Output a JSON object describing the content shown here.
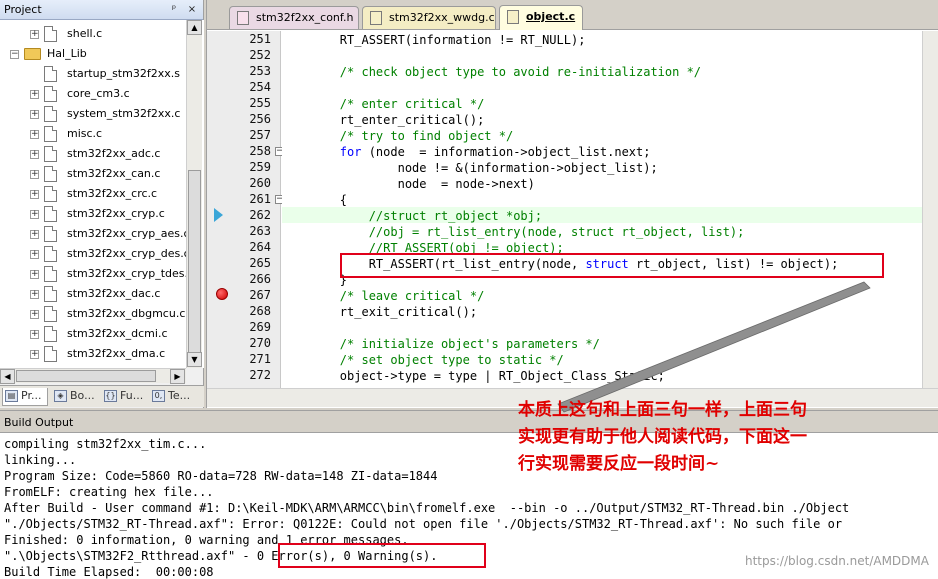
{
  "project": {
    "title": "Project",
    "pin": "ᵖ",
    "close": "×",
    "tree": [
      {
        "label": "shell.c",
        "type": "file",
        "expander": "+",
        "level": 2
      },
      {
        "label": "Hal_Lib",
        "type": "folder",
        "expander": "−",
        "level": 1
      },
      {
        "label": "startup_stm32f2xx.s",
        "type": "file",
        "expander": "",
        "level": 2
      },
      {
        "label": "core_cm3.c",
        "type": "file",
        "expander": "+",
        "level": 2
      },
      {
        "label": "system_stm32f2xx.c",
        "type": "file",
        "expander": "+",
        "level": 2
      },
      {
        "label": "misc.c",
        "type": "file",
        "expander": "+",
        "level": 2
      },
      {
        "label": "stm32f2xx_adc.c",
        "type": "file",
        "expander": "+",
        "level": 2
      },
      {
        "label": "stm32f2xx_can.c",
        "type": "file",
        "expander": "+",
        "level": 2
      },
      {
        "label": "stm32f2xx_crc.c",
        "type": "file",
        "expander": "+",
        "level": 2
      },
      {
        "label": "stm32f2xx_cryp.c",
        "type": "file",
        "expander": "+",
        "level": 2
      },
      {
        "label": "stm32f2xx_cryp_aes.c",
        "type": "file",
        "expander": "+",
        "level": 2
      },
      {
        "label": "stm32f2xx_cryp_des.c",
        "type": "file",
        "expander": "+",
        "level": 2
      },
      {
        "label": "stm32f2xx_cryp_tdes.c",
        "type": "file",
        "expander": "+",
        "level": 2
      },
      {
        "label": "stm32f2xx_dac.c",
        "type": "file",
        "expander": "+",
        "level": 2
      },
      {
        "label": "stm32f2xx_dbgmcu.c",
        "type": "file",
        "expander": "+",
        "level": 2
      },
      {
        "label": "stm32f2xx_dcmi.c",
        "type": "file",
        "expander": "+",
        "level": 2
      },
      {
        "label": "stm32f2xx_dma.c",
        "type": "file",
        "expander": "+",
        "level": 2
      }
    ],
    "tabs": [
      {
        "label": "Pr...",
        "icon": "▤"
      },
      {
        "label": "Bo...",
        "icon": "◈"
      },
      {
        "label": "Fu...",
        "icon": "{}"
      },
      {
        "label": "Te...",
        "icon": "0,"
      }
    ]
  },
  "editor": {
    "tabs": [
      {
        "label": "stm32f2xx_conf.h",
        "kind": "h",
        "active": false
      },
      {
        "label": "stm32f2xx_wwdg.c",
        "kind": "c",
        "active": false
      },
      {
        "label": "object.c",
        "kind": "c",
        "active": true
      }
    ],
    "lines": [
      {
        "no": "251",
        "fold": "",
        "segs": [
          [
            "",
            "        RT_ASSERT(information != RT_NULL);"
          ]
        ]
      },
      {
        "no": "252",
        "fold": "",
        "segs": [
          [
            "",
            ""
          ]
        ]
      },
      {
        "no": "253",
        "fold": "",
        "segs": [
          [
            "cm",
            "        /* check object type to avoid re-initialization */"
          ]
        ]
      },
      {
        "no": "254",
        "fold": "",
        "segs": [
          [
            "",
            ""
          ]
        ]
      },
      {
        "no": "255",
        "fold": "",
        "segs": [
          [
            "cm",
            "        /* enter critical */"
          ]
        ]
      },
      {
        "no": "256",
        "fold": "",
        "segs": [
          [
            "",
            "        rt_enter_critical();"
          ]
        ]
      },
      {
        "no": "257",
        "fold": "",
        "segs": [
          [
            "cm",
            "        /* try to find object */"
          ]
        ]
      },
      {
        "no": "258",
        "fold": "−",
        "segs": [
          [
            "kw",
            "        for"
          ],
          [
            "",
            " (node  = information->object_list.next;"
          ]
        ]
      },
      {
        "no": "259",
        "fold": "",
        "segs": [
          [
            "",
            "                node != &(information->object_list);"
          ]
        ]
      },
      {
        "no": "260",
        "fold": "",
        "segs": [
          [
            "",
            "                node  = node->next)"
          ]
        ]
      },
      {
        "no": "261",
        "fold": "−",
        "segs": [
          [
            "",
            "        {"
          ]
        ]
      },
      {
        "no": "262",
        "fold": "",
        "segs": [
          [
            "cm",
            "            //struct rt_object *obj;"
          ]
        ]
      },
      {
        "no": "263",
        "fold": "",
        "segs": [
          [
            "cm",
            "            //obj = rt_list_entry(node, struct rt_object, list);"
          ]
        ]
      },
      {
        "no": "264",
        "fold": "",
        "segs": [
          [
            "cm",
            "            //RT_ASSERT(obj != object);"
          ]
        ]
      },
      {
        "no": "265",
        "fold": "",
        "segs": [
          [
            "",
            "            RT_ASSERT(rt_list_entry(node, "
          ],
          [
            "kw",
            "struct"
          ],
          [
            "",
            " rt_object, list) != object);"
          ]
        ]
      },
      {
        "no": "266",
        "fold": "",
        "segs": [
          [
            "",
            "        }"
          ]
        ]
      },
      {
        "no": "267",
        "fold": "",
        "segs": [
          [
            "cm",
            "        /* leave critical */"
          ]
        ]
      },
      {
        "no": "268",
        "fold": "",
        "segs": [
          [
            "",
            "        rt_exit_critical();"
          ]
        ]
      },
      {
        "no": "269",
        "fold": "",
        "segs": [
          [
            "",
            ""
          ]
        ]
      },
      {
        "no": "270",
        "fold": "",
        "segs": [
          [
            "cm",
            "        /* initialize object's parameters */"
          ]
        ]
      },
      {
        "no": "271",
        "fold": "",
        "segs": [
          [
            "cm",
            "        /* set object type to static */"
          ]
        ]
      },
      {
        "no": "272",
        "fold": "",
        "segs": [
          [
            "",
            "        object->type = type | RT_Object_Class_Static;"
          ]
        ]
      }
    ]
  },
  "build": {
    "title": "Build Output",
    "lines": [
      "compiling stm32f2xx_tim.c...",
      "linking...",
      "Program Size: Code=5860 RO-data=728 RW-data=148 ZI-data=1844",
      "FromELF: creating hex file...",
      "After Build - User command #1: D:\\Keil-MDK\\ARM\\ARMCC\\bin\\fromelf.exe  --bin -o ../Output/STM32_RT-Thread.bin ./Object",
      "\"./Objects/STM32_RT-Thread.axf\": Error: Q0122E: Could not open file './Objects/STM32_RT-Thread.axf': No such file or",
      "Finished: 0 information, 0 warning and 1 error messages.",
      "\".\\Objects\\STM32F2_Rtthread.axf\" - 0 Error(s), 0 Warning(s).",
      "Build Time Elapsed:  00:00:08"
    ]
  },
  "annotation": {
    "lines": [
      "本质上这句和上面三句一样，上面三句",
      "实现更有助于他人阅读代码，下面这一",
      "行实现需要反应一段时间~"
    ],
    "color": "#e00000"
  },
  "watermark": "https://blog.csdn.net/AMDDMA",
  "colors": {
    "keyword": "#0000ff",
    "comment": "#008000",
    "highlight": "#eaffea",
    "annotation_box": "#e0001a"
  }
}
